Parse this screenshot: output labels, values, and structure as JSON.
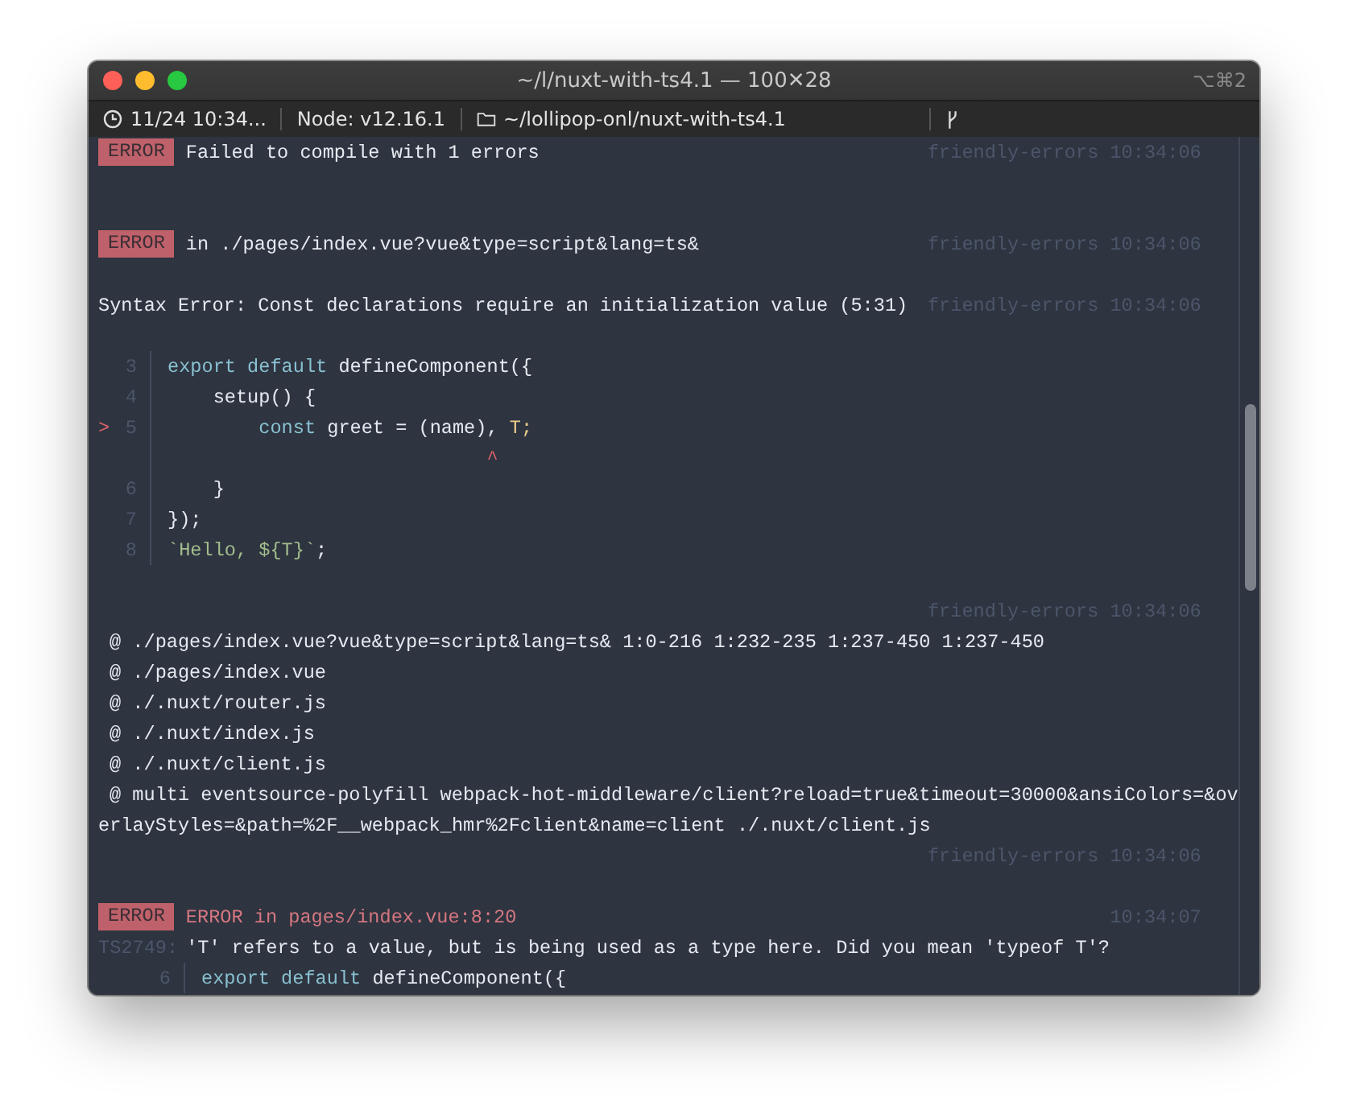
{
  "window": {
    "title": "~/l/nuxt-with-ts4.1 — 100✕28",
    "shortcut": "⌥⌘2"
  },
  "status_bar": [
    {
      "kind": "clock",
      "text": "11/24 10:34..."
    },
    {
      "kind": "plain",
      "text": "Node: v12.16.1"
    },
    {
      "kind": "folder",
      "text": "~/lollipop-onl/nuxt-with-ts4.1"
    },
    {
      "kind": "branch"
    }
  ],
  "lines": [
    {
      "kind": "log",
      "badge": "ERROR",
      "text": "Failed to compile with 1 errors",
      "meta": "friendly-errors 10:34:06"
    },
    {
      "kind": "blank"
    },
    {
      "kind": "blank"
    },
    {
      "kind": "log",
      "badge": "ERROR",
      "text": "in ./pages/index.vue?vue&type=script&lang=ts&",
      "meta": "friendly-errors 10:34:06"
    },
    {
      "kind": "blank"
    },
    {
      "kind": "text",
      "text": "Syntax Error: Const declarations require an initialization value (5:31)",
      "meta": "friendly-errors 10:34:06"
    },
    {
      "kind": "blank"
    },
    {
      "kind": "code",
      "number": "3",
      "tokens": [
        {
          "kind": "keyword",
          "text": "export default"
        },
        {
          "kind": "plain",
          "text": " defineComponent({"
        }
      ]
    },
    {
      "kind": "code",
      "number": "4",
      "tokens": [
        {
          "kind": "plain",
          "text": "    setup() {"
        }
      ]
    },
    {
      "kind": "code",
      "pointer": ">",
      "number": "5",
      "tokens": [
        {
          "kind": "keyword",
          "text": "        const"
        },
        {
          "kind": "plain",
          "text": " greet = (name), "
        },
        {
          "kind": "highlight",
          "text": "T;"
        }
      ]
    },
    {
      "kind": "code",
      "tokens": [
        {
          "kind": "caret",
          "text": "                            ^"
        }
      ]
    },
    {
      "kind": "code",
      "number": "6",
      "tokens": [
        {
          "kind": "plain",
          "text": "    }"
        }
      ]
    },
    {
      "kind": "code",
      "number": "7",
      "tokens": [
        {
          "kind": "plain",
          "text": "});"
        }
      ]
    },
    {
      "kind": "code",
      "number": "8",
      "tokens": [
        {
          "kind": "string",
          "text": "`Hello, ${T}`"
        },
        {
          "kind": "plain",
          "text": ";"
        }
      ]
    },
    {
      "kind": "blank"
    },
    {
      "kind": "meta",
      "meta": "friendly-errors 10:34:06"
    },
    {
      "kind": "trace",
      "text": "@ ./pages/index.vue?vue&type=script&lang=ts& 1:0-216 1:232-235 1:237-450 1:237-450"
    },
    {
      "kind": "trace",
      "text": "@ ./pages/index.vue"
    },
    {
      "kind": "trace",
      "text": "@ ./.nuxt/router.js"
    },
    {
      "kind": "trace",
      "text": "@ ./.nuxt/index.js"
    },
    {
      "kind": "trace",
      "text": "@ ./.nuxt/client.js"
    },
    {
      "kind": "trace",
      "text": "@ multi eventsource-polyfill webpack-hot-middleware/client?reload=true&timeout=30000&ansiColors=&ov"
    },
    {
      "kind": "text",
      "text": "erlayStyles=&path=%2F__webpack_hmr%2Fclient&name=client ./.nuxt/client.js"
    },
    {
      "kind": "meta",
      "meta": "friendly-errors 10:34:06"
    },
    {
      "kind": "blank"
    },
    {
      "kind": "error-log",
      "badge": "ERROR",
      "text": "ERROR in pages/index.vue:8:20",
      "meta": "10:34:07"
    },
    {
      "kind": "ts",
      "code": "TS2749:",
      "text": "'T' refers to a value, but is being used as a type here. Did you mean 'typeof T'?"
    },
    {
      "kind": "nested-code",
      "number": "6",
      "tokens": [
        {
          "kind": "keyword",
          "text": "export default"
        },
        {
          "kind": "plain",
          "text": " defineComponent({"
        }
      ]
    }
  ]
}
